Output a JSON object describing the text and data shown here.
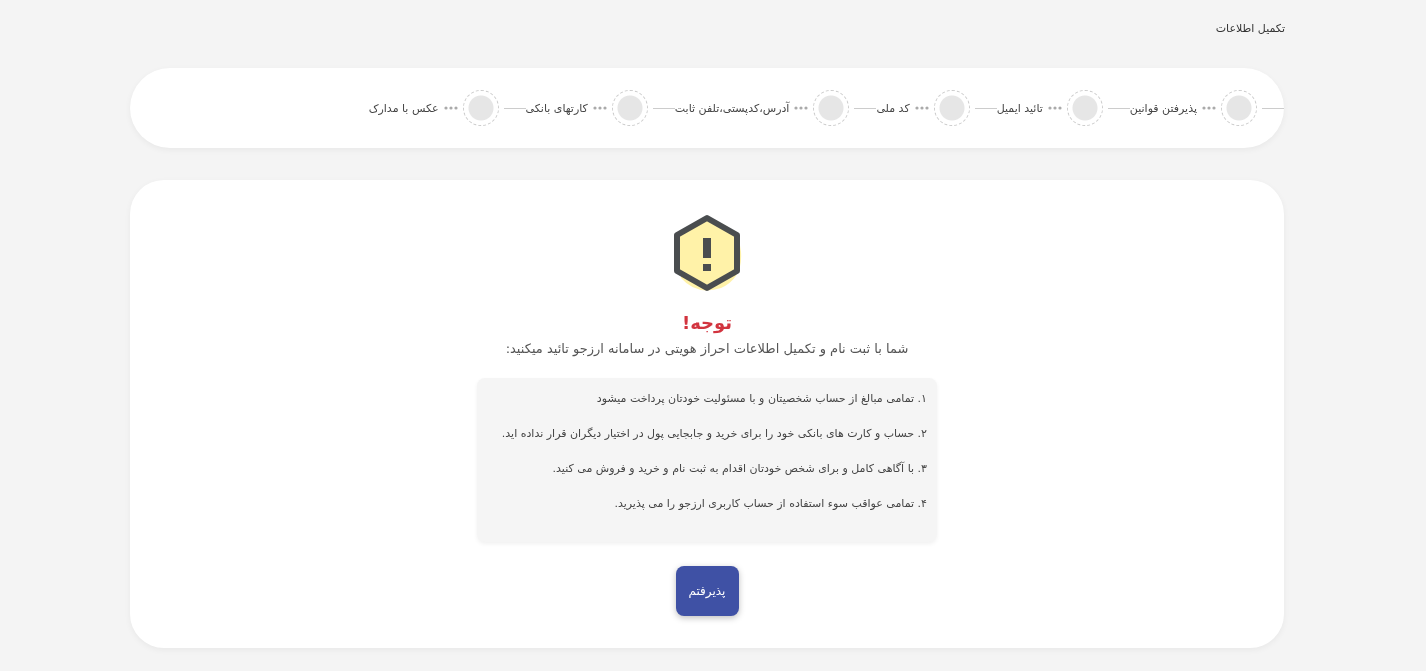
{
  "page": {
    "title": "تکمیل اطلاعات"
  },
  "steps": [
    {
      "label": "پذیرفتن قوانین"
    },
    {
      "label": "تائید ایمیل"
    },
    {
      "label": "کد ملی"
    },
    {
      "label": "آدرس،کدپستی،تلفن ثابت"
    },
    {
      "label": "کارتهای بانکی"
    },
    {
      "label": "عکس با مدارک"
    }
  ],
  "notice": {
    "heading": "توجه!",
    "intro": "شما با ثبت نام و تکمیل اطلاعات احراز هویتی در سامانه ارزجو تائید میکنید:",
    "items": [
      "۱. تمامی مبالغ از حساب شخصیتان و با مسئولیت خودتان پرداخت میشود",
      "۲. حساب و کارت های بانکی خود را برای خرید و جابجایی پول در اختیار دیگران قرار نداده اید.",
      "۳. با آگاهی کامل و برای شخص خودتان اقدام به ثبت نام و خرید و فروش می کنید.",
      "۴. تمامی عواقب سوء استفاده از حساب کاربری ارزجو را می پذیرید."
    ],
    "button": "پذیرفتم"
  }
}
